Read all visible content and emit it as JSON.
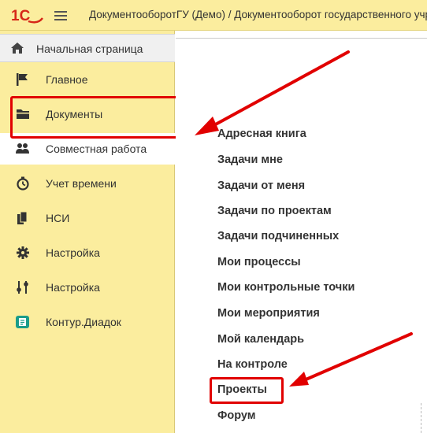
{
  "app": {
    "title": "ДокументооборотГУ (Демо) / Документооборот государственного учреждения",
    "logo_text": "1С",
    "colors": {
      "panel": "#fbed9e",
      "accent": "#e10000",
      "text": "#333333"
    }
  },
  "sidebar": {
    "home": {
      "label": "Начальная страница",
      "icon": "home-icon"
    },
    "items": [
      {
        "label": "Главное",
        "icon": "flag-icon"
      },
      {
        "label": "Документы",
        "icon": "folder-icon"
      },
      {
        "label": "Совместная работа",
        "icon": "people-icon",
        "active": true
      },
      {
        "label": "Учет времени",
        "icon": "stopwatch-icon"
      },
      {
        "label": "НСИ",
        "icon": "books-icon"
      },
      {
        "label": "Настройка",
        "icon": "gear-icon"
      },
      {
        "label": "Настройка",
        "icon": "sliders-icon"
      },
      {
        "label": "Контур.Диадок",
        "icon": "diadoc-icon"
      }
    ]
  },
  "content": {
    "links": [
      "Адресная книга",
      "Задачи мне",
      "Задачи от меня",
      "Задачи по проектам",
      "Задачи подчиненных",
      "Мои процессы",
      "Мои контрольные точки",
      "Мои мероприятия",
      "Мой календарь",
      "На контроле",
      "Проекты",
      "Форум"
    ]
  }
}
